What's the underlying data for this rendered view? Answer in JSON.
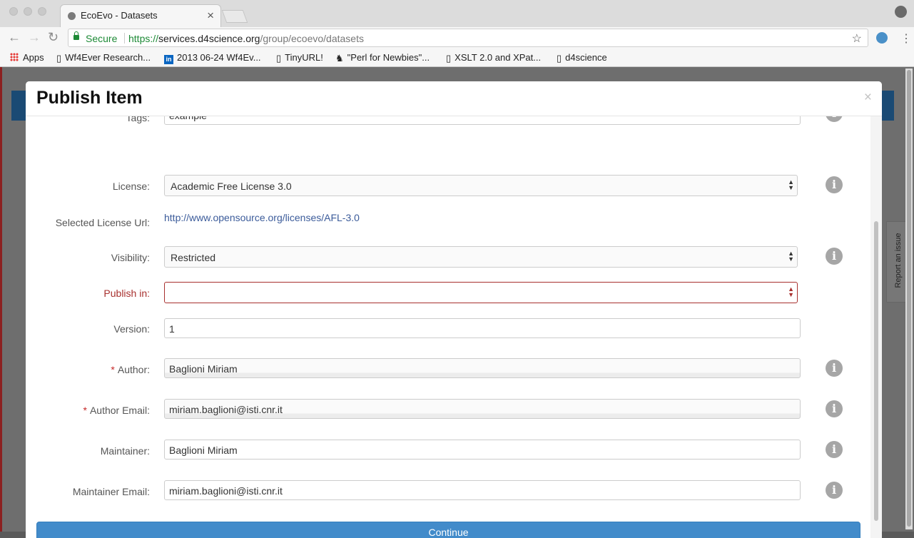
{
  "browser": {
    "tab_title": "EcoEvo - Datasets",
    "tab_close": "×",
    "secure_label": "Secure",
    "url_protocol": "https://",
    "url_host": "services.d4science.org",
    "url_path": "/group/ecoevo/datasets",
    "bookmarks": [
      "Apps",
      "Wf4Ever Research...",
      "2013 06-24 Wf4Ev...",
      "TinyURL!",
      "\"Perl for Newbies\"...",
      "XSLT 2.0 and XPat...",
      "d4science"
    ]
  },
  "page": {
    "report_issue": "Report an issue"
  },
  "modal": {
    "title": "Publish Item",
    "close": "×",
    "fields": {
      "tags": {
        "label": "Tags:",
        "value": "example"
      },
      "license": {
        "label": "License:",
        "value": "Academic Free License 3.0"
      },
      "license_url": {
        "label": "Selected License Url:",
        "value": "http://www.opensource.org/licenses/AFL-3.0"
      },
      "visibility": {
        "label": "Visibility:",
        "value": "Restricted"
      },
      "publish_in": {
        "label": "Publish in:",
        "value": ""
      },
      "version": {
        "label": "Version:",
        "value": "1"
      },
      "author": {
        "label": "Author:",
        "value": "Baglioni Miriam"
      },
      "author_email": {
        "label": "Author Email:",
        "value": "miriam.baglioni@isti.cnr.it"
      },
      "maintainer": {
        "label": "Maintainer:",
        "value": "Baglioni Miriam"
      },
      "maintainer_email": {
        "label": "Maintainer Email:",
        "value": "miriam.baglioni@isti.cnr.it"
      }
    },
    "required_marker": "*",
    "continue_label": "Continue"
  },
  "colors": {
    "accent": "#428bca",
    "error": "#a8302e",
    "secure_green": "#1d8a36"
  }
}
